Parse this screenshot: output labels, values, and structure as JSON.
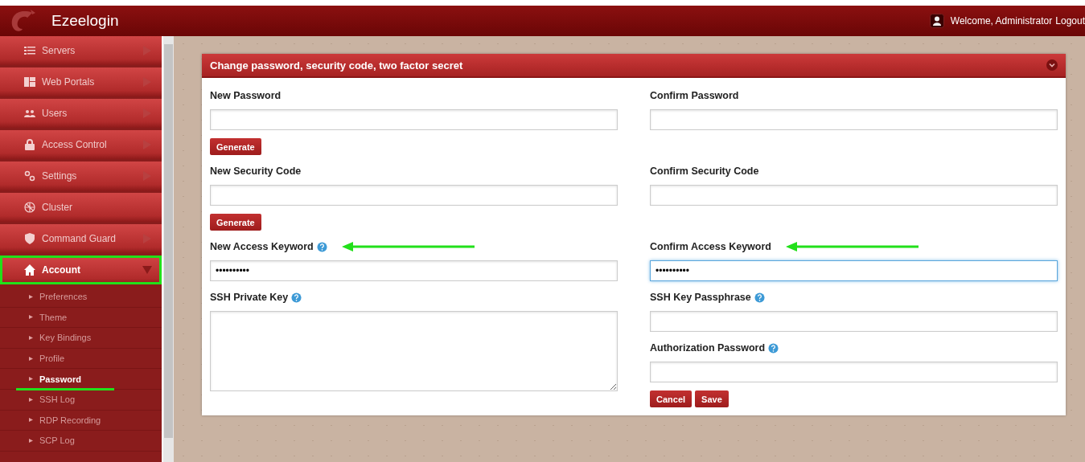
{
  "header": {
    "brand": "Ezeelogin",
    "welcome": "Welcome, Administrator",
    "logout": "Logout"
  },
  "sidebar": {
    "items": [
      {
        "label": "Servers",
        "has_arrow": true,
        "expanded": false,
        "annotated": false
      },
      {
        "label": "Web Portals",
        "has_arrow": true,
        "expanded": false,
        "annotated": false
      },
      {
        "label": "Users",
        "has_arrow": true,
        "expanded": false,
        "annotated": false
      },
      {
        "label": "Access Control",
        "has_arrow": true,
        "expanded": false,
        "annotated": false
      },
      {
        "label": "Settings",
        "has_arrow": true,
        "expanded": false,
        "annotated": false
      },
      {
        "label": "Cluster",
        "has_arrow": false,
        "expanded": false,
        "annotated": false
      },
      {
        "label": "Command Guard",
        "has_arrow": true,
        "expanded": false,
        "annotated": false
      },
      {
        "label": "Account",
        "has_arrow": true,
        "expanded": true,
        "annotated": true,
        "children": [
          {
            "label": "Preferences",
            "selected": false,
            "annotated": false
          },
          {
            "label": "Theme",
            "selected": false,
            "annotated": false
          },
          {
            "label": "Key Bindings",
            "selected": false,
            "annotated": false
          },
          {
            "label": "Profile",
            "selected": false,
            "annotated": false
          },
          {
            "label": "Password",
            "selected": true,
            "annotated": true
          },
          {
            "label": "SSH Log",
            "selected": false,
            "annotated": false
          },
          {
            "label": "RDP Recording",
            "selected": false,
            "annotated": false
          },
          {
            "label": "SCP Log",
            "selected": false,
            "annotated": false
          }
        ]
      }
    ]
  },
  "panel": {
    "title": "Change password, security code, two factor secret",
    "rows": [
      {
        "cells": [
          [
            {
              "kind": "input",
              "label": "New Password",
              "focused": false,
              "button": "Generate"
            }
          ],
          [
            {
              "kind": "input",
              "label": "Confirm Password",
              "focused": false
            }
          ]
        ]
      },
      {
        "cells": [
          [
            {
              "kind": "input",
              "label": "New Security Code",
              "focused": false,
              "button": "Generate"
            }
          ],
          [
            {
              "kind": "input",
              "label": "Confirm Security Code",
              "focused": false
            }
          ]
        ]
      },
      {
        "cells": [
          [
            {
              "kind": "input",
              "label": "New Access Keyword",
              "help": true,
              "value": "••••••••••",
              "focused": false,
              "annotated": true
            }
          ],
          [
            {
              "kind": "input",
              "label": "Confirm Access Keyword",
              "value": "••••••••••",
              "focused": true,
              "annotated": true
            }
          ]
        ]
      },
      {
        "cells": [
          [
            {
              "kind": "textarea",
              "label": "SSH Private Key",
              "help": true,
              "focused": false
            }
          ],
          [
            {
              "kind": "input",
              "label": "SSH Key Passphrase",
              "help": true,
              "focused": false
            },
            {
              "kind": "input",
              "label": "Authorization Password",
              "help": true,
              "focused": false
            }
          ]
        ]
      }
    ],
    "actions": [
      "Cancel",
      "Save"
    ]
  }
}
